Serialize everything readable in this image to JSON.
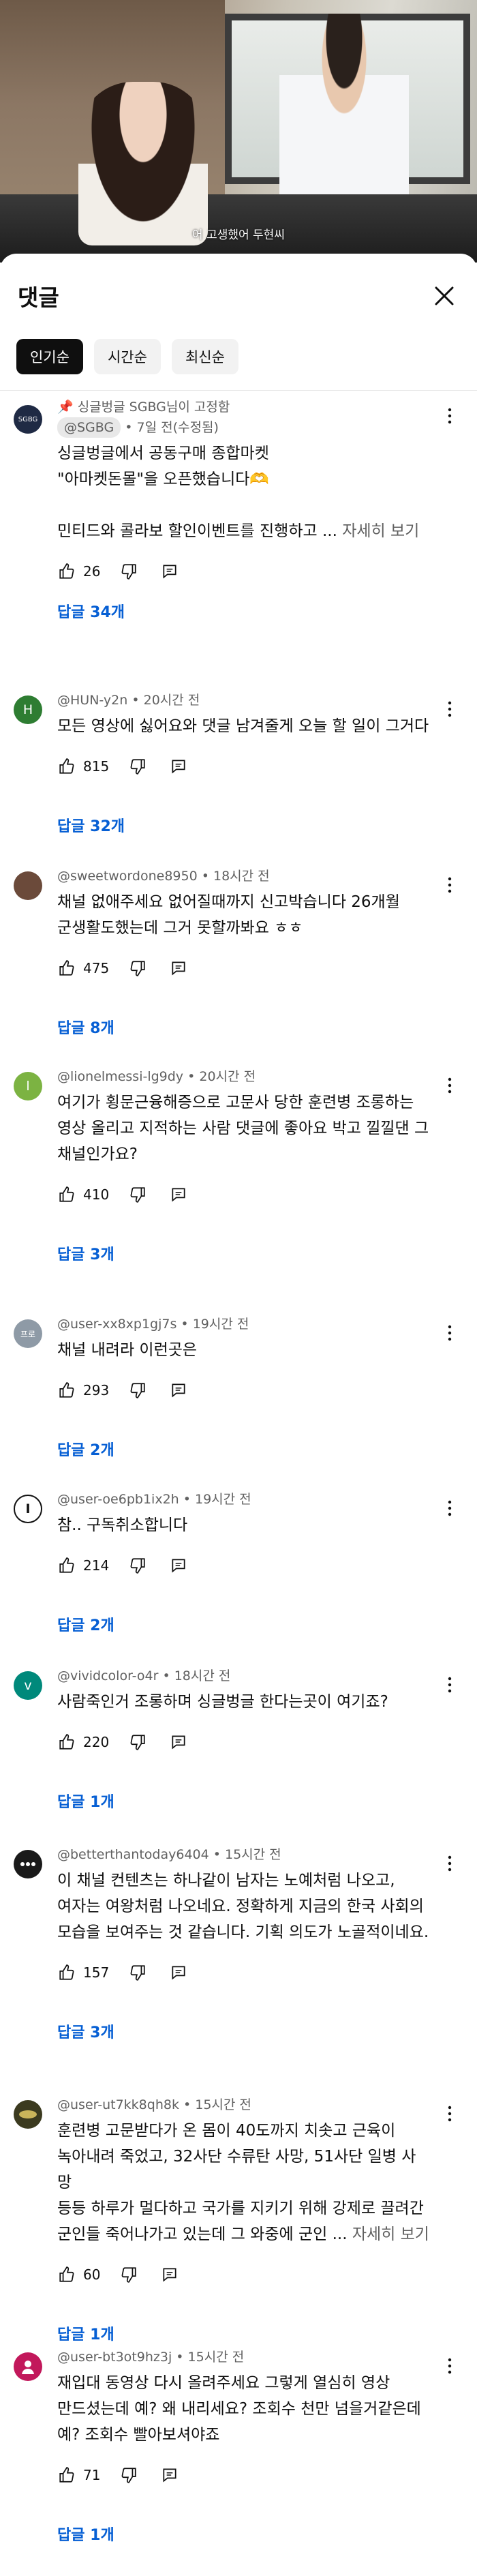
{
  "video": {
    "caption": "어 고생했어 두현씨"
  },
  "sheet": {
    "title": "댓글",
    "sort_chips": [
      "인기순",
      "시간순",
      "최신순"
    ]
  },
  "comments": [
    {
      "pinned_label": "싱글벙글 SGBG님이 고정함",
      "author": "@SGBG",
      "time": "7일 전(수정됨)",
      "text": "싱글벙글에서 공동구매 종합마켓\n\"아마켓돈몰\"을 오픈했습니다🫶\n\n민티드와 콜라보 할인이벤트를 진행하고 ...",
      "more": "자세히 보기",
      "likes": "26",
      "replies": "답글 34개",
      "avatar_color": "#1f2a44",
      "avatar_text": "SGBG"
    },
    {
      "author": "@HUN-y2n",
      "time": "20시간 전",
      "text": "모든 영상에 싫어요와 댓글 남겨줄게 오늘 할 일이 그거다",
      "likes": "815",
      "replies": "답글 32개",
      "avatar_color": "#2e7d32",
      "avatar_text": "H"
    },
    {
      "author": "@sweetwordone8950",
      "time": "18시간 전",
      "text": "채널 없애주세요 없어질때까지 신고박습니다 26개월\n군생활도했는데 그거 못할까봐요 ㅎㅎ",
      "likes": "475",
      "replies": "답글 8개",
      "avatar_color": "#6b4a3a",
      "avatar_text": ""
    },
    {
      "author": "@lionelmessi-lg9dy",
      "time": "20시간 전",
      "text": "여기가 횡문근융해증으로 고문사 당한 훈련병 조롱하는\n영상 올리고 지적하는 사람 댓글에 좋아요 박고 낄낄댄 그\n채널인가요?",
      "likes": "410",
      "replies": "답글 3개",
      "avatar_color": "#7cb342",
      "avatar_text": "l"
    },
    {
      "author": "@user-xx8xp1gj7s",
      "time": "19시간 전",
      "text": "채널 내려라 이런곳은",
      "likes": "293",
      "replies": "답글 2개",
      "avatar_color": "#8e9aa6",
      "avatar_text": "프로"
    },
    {
      "author": "@user-oe6pb1ix2h",
      "time": "19시간 전",
      "text": "참.. 구독취소합니다",
      "likes": "214",
      "replies": "답글 2개",
      "avatar_color": "#111111",
      "avatar_text": "I"
    },
    {
      "author": "@vividcolor-o4r",
      "time": "18시간 전",
      "text": "사람죽인거 조롱하며 싱글벙글 한다는곳이 여기죠?",
      "likes": "220",
      "replies": "답글 1개",
      "avatar_color": "#00897b",
      "avatar_text": "v"
    },
    {
      "author": "@betterthantoday6404",
      "time": "15시간 전",
      "text": "이 채널 컨텐츠는 하나같이 남자는 노예처럼 나오고,\n여자는 여왕처럼 나오네요. 정확하게 지금의 한국 사회의\n모습을 보여주는 것 같습니다. 기획 의도가 노골적이네요.",
      "likes": "157",
      "replies": "답글 3개",
      "avatar_color": "#1a1a1a",
      "avatar_text": ""
    },
    {
      "author": "@user-ut7kk8qh8k",
      "time": "15시간 전",
      "text": "훈련병 고문받다가 온 몸이 40도까지 치솟고 근육이\n녹아내려 죽었고, 32사단 수류탄 사망, 51사단 일병 사망\n등등 하루가 멀다하고 국가를 지키기 위해 강제로 끌려간\n군인들 죽어나가고 있는데 그 와중에 군인 ...",
      "more": "자세히 보기",
      "likes": "60",
      "replies": "답글 1개",
      "avatar_color": "#3b3a1f",
      "avatar_text": ""
    },
    {
      "author": "@user-bt3ot9hz3j",
      "time": "15시간 전",
      "text": "재입대 동영상 다시 올려주세요 그렇게 열심히 영상\n만드셨는데 예? 왜 내리세요? 조회수 천만 넘을거같은데\n예? 조회수 빨아보셔야죠",
      "likes": "71",
      "replies": "답글 1개",
      "avatar_color": "#c2185b",
      "avatar_text": ""
    }
  ]
}
